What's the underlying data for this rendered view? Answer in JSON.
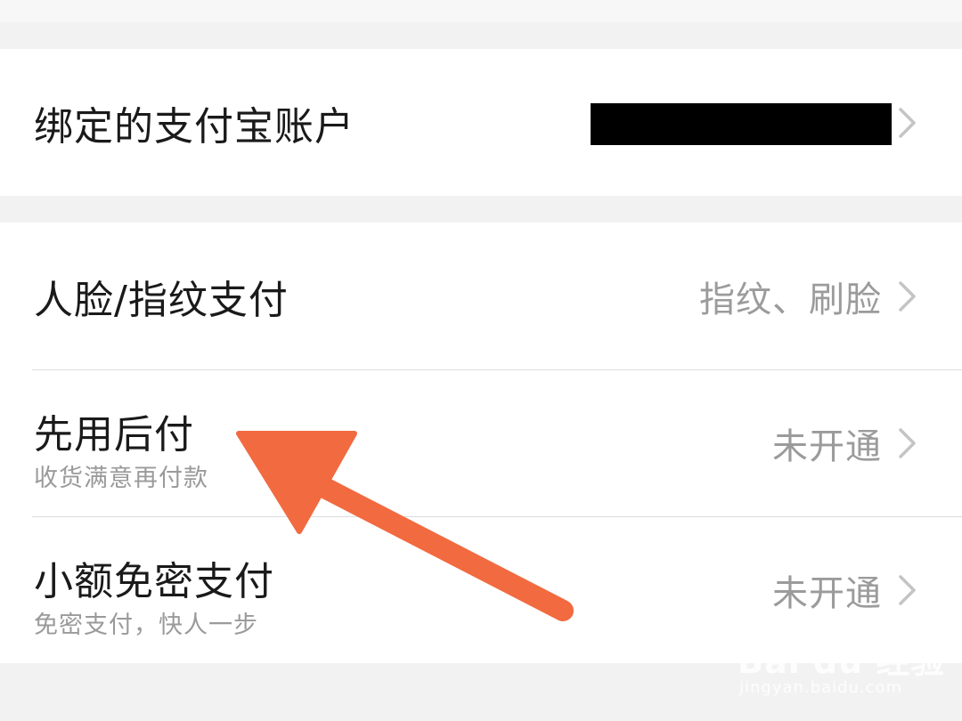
{
  "account_section": {
    "title": "绑定的支付宝账户"
  },
  "payment_section": {
    "items": [
      {
        "title": "人脸/指纹支付",
        "subtitle": "",
        "value": "指纹、刷脸"
      },
      {
        "title": "先用后付",
        "subtitle": "收货满意再付款",
        "value": "未开通"
      },
      {
        "title": "小额免密支付",
        "subtitle": "免密支付，快人一步",
        "value": "未开通"
      }
    ]
  },
  "annotation": {
    "arrow_color": "#f26a40"
  },
  "watermark": {
    "brand": "Bai du 经验",
    "url": "jingyan.baidu.com"
  },
  "icons": {
    "chevron": "chevron-right-icon"
  }
}
